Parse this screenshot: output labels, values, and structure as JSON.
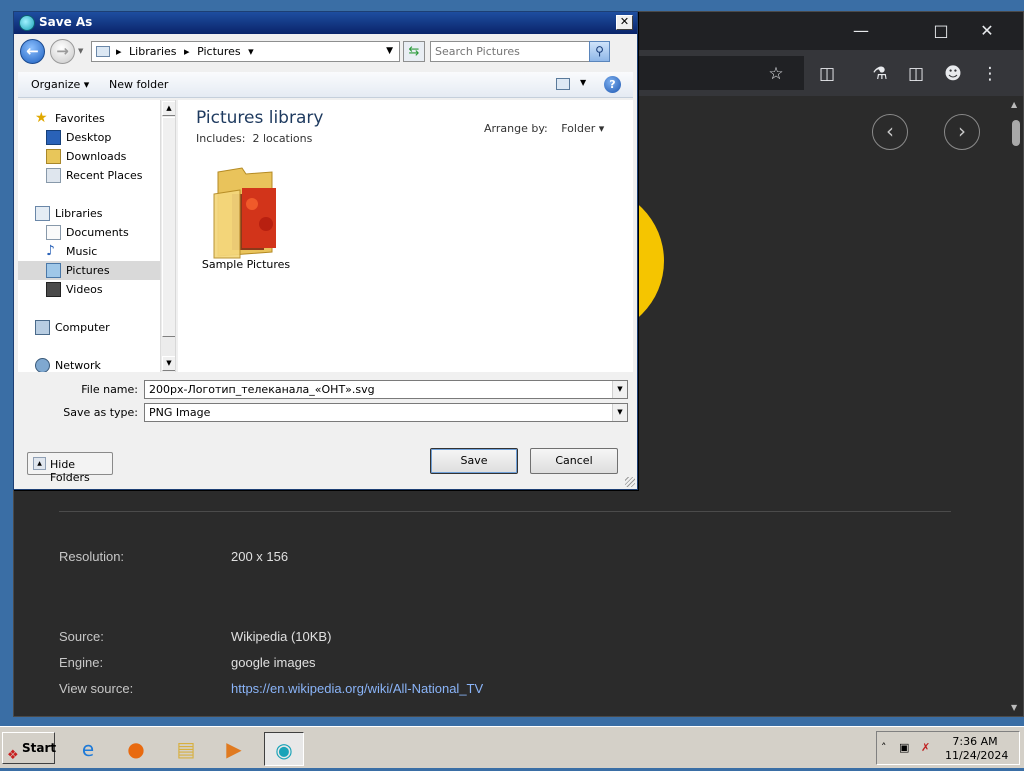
{
  "browser": {
    "content": {
      "info_rows": [
        {
          "label": "Resolution:",
          "value": "200 x 156"
        },
        {
          "label": "Source:",
          "value": "Wikipedia (10KB)"
        },
        {
          "label": "Engine:",
          "value": "google images"
        },
        {
          "label": "View source:",
          "value": "https://en.wikipedia.org/wiki/All-National_TV"
        }
      ]
    }
  },
  "dialog": {
    "title": "Save As",
    "address": {
      "crumbs": [
        "Libraries",
        "Pictures"
      ]
    },
    "search_placeholder": "Search Pictures",
    "commands": {
      "organize": "Organize",
      "new_folder": "New folder"
    },
    "nav": {
      "favorites": "Favorites",
      "favorites_items": [
        "Desktop",
        "Downloads",
        "Recent Places"
      ],
      "libraries": "Libraries",
      "libraries_items": [
        "Documents",
        "Music",
        "Pictures",
        "Videos"
      ],
      "computer": "Computer",
      "network": "Network",
      "selected": "Pictures"
    },
    "library": {
      "title": "Pictures library",
      "includes_label": "Includes:",
      "locations": "2 locations",
      "arrange_label": "Arrange by:",
      "arrange_value": "Folder"
    },
    "files": [
      {
        "name": "Sample Pictures"
      }
    ],
    "file_name_label": "File name:",
    "file_name_value": "200px-Логотип_телеканала_«ОНТ».svg",
    "save_as_type_label": "Save as type:",
    "save_as_type_value": "PNG Image",
    "hide_folders": "Hide Folders",
    "save": "Save",
    "cancel": "Cancel"
  },
  "taskbar": {
    "start": "Start",
    "apps": [
      "internet-explorer-icon",
      "firefox-icon",
      "file-explorer-icon",
      "media-player-icon",
      "screenshot-app-icon"
    ],
    "clock_time": "7:36 AM",
    "clock_date": "11/24/2024"
  }
}
